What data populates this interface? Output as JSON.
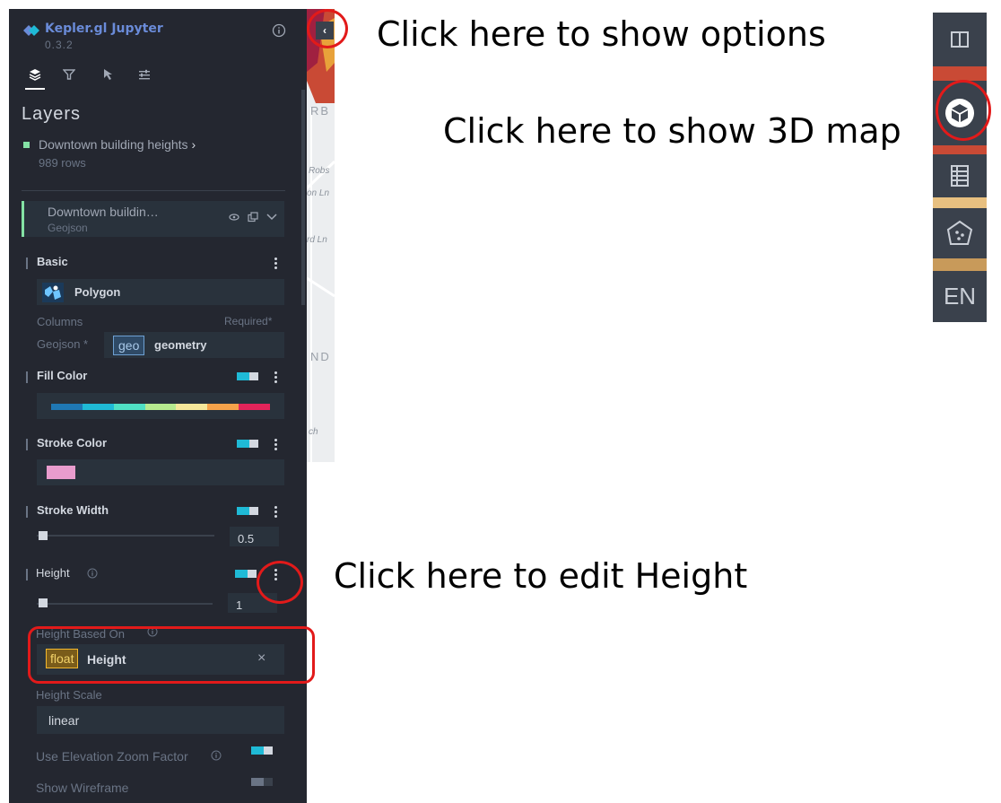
{
  "app": {
    "title": "Kepler.gl Jupyter",
    "version": "0.3.2"
  },
  "panel_tabs": [
    {
      "name": "layers",
      "icon": "layers-icon",
      "active": true
    },
    {
      "name": "filters",
      "icon": "filter-icon",
      "active": false
    },
    {
      "name": "interactions",
      "icon": "cursor-icon",
      "active": false
    },
    {
      "name": "map-settings",
      "icon": "sliders-icon",
      "active": false
    }
  ],
  "layers_title": "Layers",
  "dataset": {
    "name": "Downtown building heights",
    "chevron": "›",
    "rows": "989 rows",
    "color": "#84e2a5"
  },
  "layer_card": {
    "name": "Downtown buildin…",
    "type": "Geojson"
  },
  "basic": {
    "label": "Basic",
    "type_value": "Polygon",
    "columns_label": "Columns",
    "required_label": "Required*",
    "geojson_label": "Geojson *",
    "geojson_tag": "geo",
    "geojson_value": "geometry"
  },
  "fill_color": {
    "label": "Fill Color",
    "palette": [
      "#1f78b4",
      "#1fbad6",
      "#4fe0c4",
      "#b6ea8f",
      "#f5e79a",
      "#f5a24a",
      "#e3245a"
    ]
  },
  "stroke_color": {
    "label": "Stroke Color",
    "swatch": "#e89ccd"
  },
  "stroke_width": {
    "label": "Stroke Width",
    "value": "0.5",
    "level": 0.0
  },
  "height": {
    "label": "Height",
    "value": "1",
    "level": 0.0
  },
  "height_based_on": {
    "label": "Height Based On",
    "tag": "float",
    "value": "Height",
    "clear": "×"
  },
  "height_scale": {
    "label": "Height Scale",
    "value": "linear"
  },
  "elevation_zoom": {
    "label": "Use Elevation Zoom Factor",
    "on": true
  },
  "wireframe": {
    "label": "Show Wireframe",
    "on": false
  },
  "map_labels": [
    "RB",
    "Robs",
    "on Ln",
    "rd Ln",
    "ND",
    "ch"
  ],
  "toolbar": {
    "en_label": "EN"
  },
  "annotations": {
    "show_options": "Click here to show options",
    "show_3d": "Click here to show 3D map",
    "edit_height": "Click here to edit Height"
  },
  "colors": {
    "panel_bg": "#242730",
    "field_bg": "#29323c",
    "accent": "#1fbad6",
    "highlight_red": "#e21a1a"
  }
}
